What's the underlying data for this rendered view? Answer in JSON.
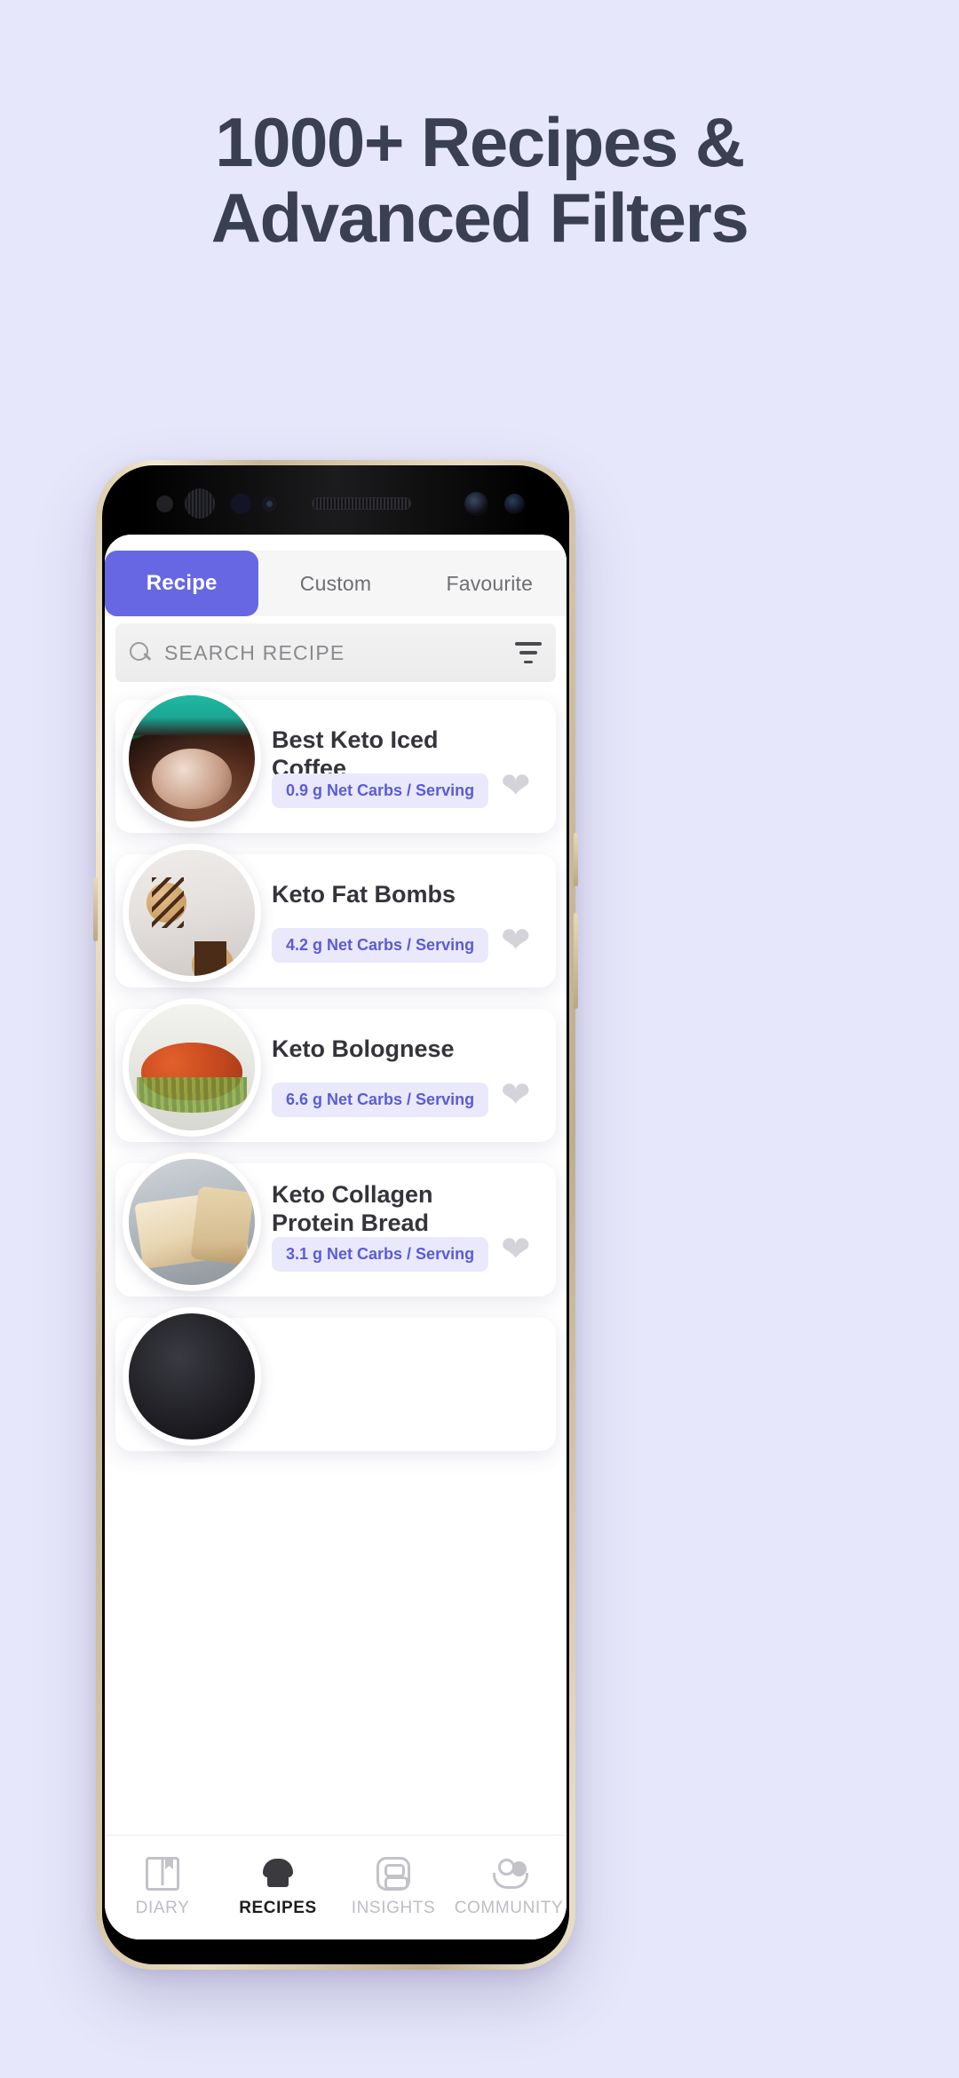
{
  "headline": {
    "line1": "1000+ Recipes &",
    "line2": "Advanced Filters",
    "color": "#3b3f52"
  },
  "background_color": "#e7e7fb",
  "accent_color": "#6767e3",
  "app": {
    "tabs": [
      {
        "label": "Recipe",
        "active": true
      },
      {
        "label": "Custom",
        "active": false
      },
      {
        "label": "Favourite",
        "active": false
      }
    ],
    "search": {
      "placeholder": "SEARCH RECIPE",
      "search_icon": "search-icon",
      "filter_icon": "filter-icon"
    },
    "recipes": [
      {
        "title": "Best Keto Iced Coffee",
        "badge": "0.9 g Net Carbs / Serving",
        "favourite_icon": "heart-icon"
      },
      {
        "title": "Keto Fat Bombs",
        "badge": "4.2 g Net Carbs / Serving",
        "favourite_icon": "heart-icon"
      },
      {
        "title": "Keto Bolognese",
        "badge": "6.6 g Net Carbs / Serving",
        "favourite_icon": "heart-icon"
      },
      {
        "title": "Keto Collagen Protein Bread",
        "badge": "3.1 g Net Carbs / Serving",
        "favourite_icon": "heart-icon"
      }
    ],
    "bottom_nav": [
      {
        "label": "DIARY",
        "icon": "book-icon",
        "active": false
      },
      {
        "label": "RECIPES",
        "icon": "chef-hat-icon",
        "active": true
      },
      {
        "label": "INSIGHTS",
        "icon": "insights-icon",
        "active": false
      },
      {
        "label": "COMMUNITY",
        "icon": "community-icon",
        "active": false
      }
    ]
  }
}
